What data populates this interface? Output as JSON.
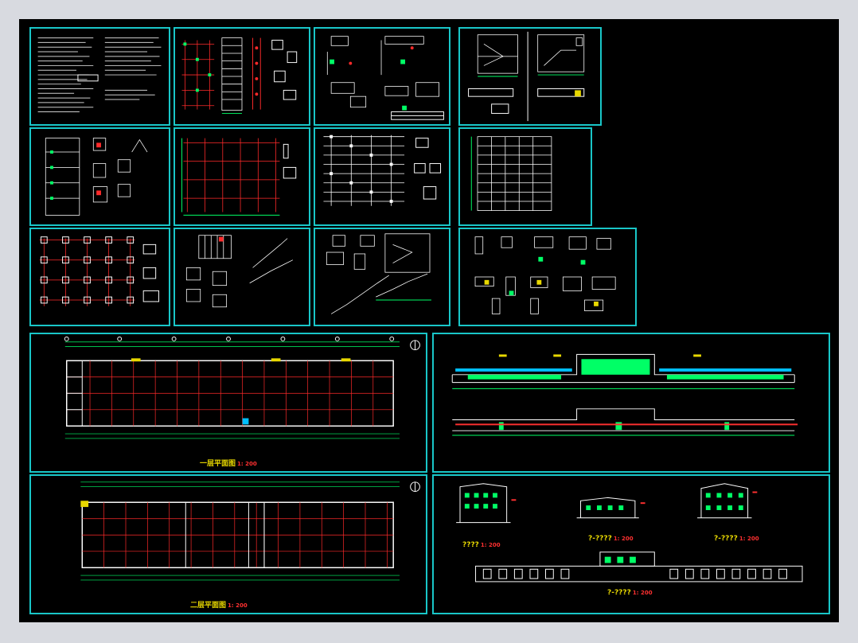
{
  "colors": {
    "background": "#000000",
    "frame": "#19c6c8",
    "grid": "#ff2a2a",
    "walls": "#ffffff",
    "dimension": "#00ff66",
    "text": "#e8d800",
    "highlight": "#ff3030"
  },
  "plans": {
    "first_floor": {
      "title": "一层平面图",
      "scale": "1: 200"
    },
    "second_floor": {
      "title": "二层平面图",
      "scale": "1: 200"
    }
  },
  "sections": {
    "section_a": {
      "title": "????",
      "scale": "1: 200"
    },
    "section_b": {
      "title": "?-????",
      "scale": "1: 200"
    },
    "section_c": {
      "title": "?-????",
      "scale": "1: 200"
    },
    "section_d": {
      "title": "?-????",
      "scale": "1: 200"
    }
  }
}
